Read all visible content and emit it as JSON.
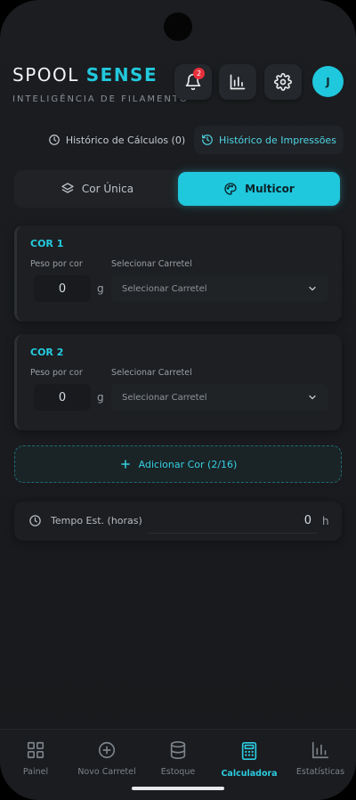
{
  "header": {
    "brand_part1": "SPOOL ",
    "brand_part2": "SENSE",
    "tagline": "INTELIGÊNCIA DE FILAMENTO",
    "notification_count": "2",
    "avatar_initial": "J"
  },
  "history_tabs": {
    "calculations": "Histórico de Cálculos (0)",
    "prints": "Histórico de Impressões"
  },
  "mode": {
    "single": "Cor Única",
    "multi": "Multicor",
    "selected": "Multicor"
  },
  "colors": [
    {
      "title": "COR 1",
      "weight_label": "Peso por cor",
      "spool_label": "Selecionar Carretel",
      "weight_value": "0",
      "unit": "g",
      "spool_placeholder": "Selecionar Carretel"
    },
    {
      "title": "COR 2",
      "weight_label": "Peso por cor",
      "spool_label": "Selecionar Carretel",
      "weight_value": "0",
      "unit": "g",
      "spool_placeholder": "Selecionar Carretel"
    }
  ],
  "add_color": {
    "label": "Adicionar Cor (2/16)"
  },
  "time": {
    "label": "Tempo Est. (horas)",
    "value": "0",
    "unit": "h"
  },
  "nav": {
    "items": [
      "Painel",
      "Novo Carretel",
      "Estoque",
      "Calculadora",
      "Estatísticas"
    ],
    "active": "Calculadora"
  },
  "colors_theme": {
    "accent": "#1fc8dd",
    "badge": "#e5303b",
    "background": "#1b1d20"
  }
}
